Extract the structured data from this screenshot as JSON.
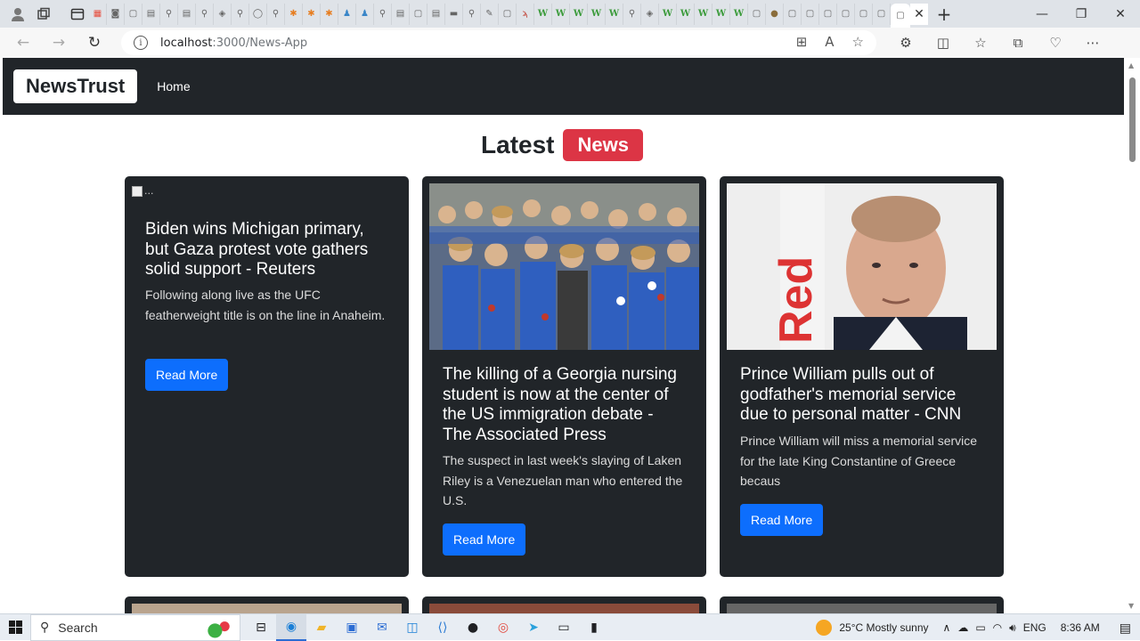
{
  "browser": {
    "address": {
      "host": "localhost",
      "path": ":3000/News-App"
    },
    "window_controls": {
      "minimize": "—",
      "restore": "❐",
      "close": "✕"
    },
    "tab_close": "✕",
    "new_tab": "+"
  },
  "navbar": {
    "brand": "NewsTrust",
    "home": "Home"
  },
  "page": {
    "heading": "Latest",
    "badge": "News"
  },
  "cards": [
    {
      "image_alt": "...",
      "title": "Biden wins Michigan primary, but Gaza protest vote gathers solid support - Reuters",
      "description": "Following along live as the UFC featherweight title is on the line in Anaheim.",
      "button": "Read More"
    },
    {
      "title": "The killing of a Georgia nursing student is now at the center of the US immigration debate - The Associated Press",
      "description": "The suspect in last week's slaying of Laken Riley is a Venezuelan man who entered the U.S.",
      "button": "Read More"
    },
    {
      "title": "Prince William pulls out of godfather's memorial service due to personal matter - CNN",
      "description": "Prince William will miss a memorial service for the late King Constantine of Greece becaus",
      "button": "Read More"
    }
  ],
  "colors": {
    "navbar": "#212529",
    "badge": "#dc3545",
    "button": "#0d6efd"
  },
  "taskbar": {
    "search": "Search",
    "weather": "25°C  Mostly sunny",
    "lang": "ENG",
    "time": "8:36 AM"
  }
}
